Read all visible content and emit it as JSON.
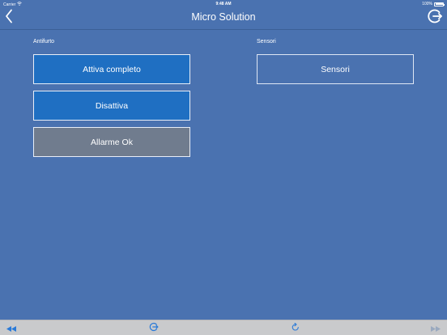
{
  "status_bar": {
    "carrier": "Carrier",
    "time": "9:48 AM",
    "battery": "100%"
  },
  "nav": {
    "title": "Micro Solution"
  },
  "sections": {
    "antifurto": {
      "label": "Antifurto",
      "buttons": [
        {
          "label": "Attiva completo"
        },
        {
          "label": "Disattiva"
        },
        {
          "label": "Allarme Ok"
        }
      ]
    },
    "sensori": {
      "label": "Sensori",
      "buttons": [
        {
          "label": "Sensori"
        }
      ]
    }
  },
  "icons": {
    "back": "chevron-left-icon",
    "logout": "logout-icon",
    "rewind": "rewind-icon",
    "toolbar_logout": "logout-icon",
    "refresh": "refresh-icon",
    "forward": "fast-forward-icon"
  },
  "colors": {
    "background": "#4a72b0",
    "button_blue": "#1f6fc2",
    "button_gray": "#707c8e",
    "toolbar": "#c9cacc",
    "toolbar_icon": "#2a7ad8"
  }
}
